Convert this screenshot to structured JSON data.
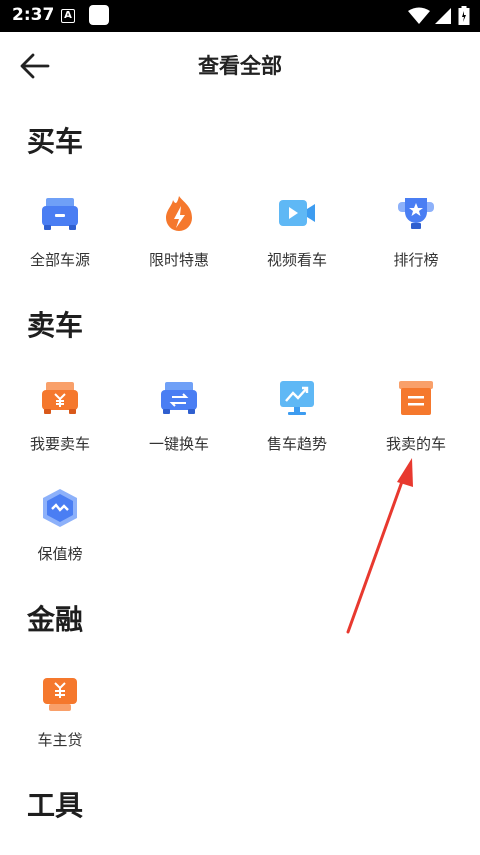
{
  "status_bar": {
    "time": "2:37",
    "icon_a": "A"
  },
  "header": {
    "title": "查看全部"
  },
  "sections": [
    {
      "title": "买车",
      "items": [
        "全部车源",
        "限时特惠",
        "视频看车",
        "排行榜"
      ]
    },
    {
      "title": "卖车",
      "items": [
        "我要卖车",
        "一键换车",
        "售车趋势",
        "我卖的车",
        "保值榜"
      ]
    },
    {
      "title": "金融",
      "items": [
        "车主贷"
      ]
    },
    {
      "title": "工具",
      "items": []
    }
  ],
  "icons": {
    "all-cars": "car-front-icon",
    "limited-offer": "flame-icon",
    "video-view": "video-camera-icon",
    "ranking": "trophy-icon",
    "sell-car": "car-yen-icon",
    "trade-in": "car-swap-icon",
    "sell-trend": "trend-chart-icon",
    "my-sold": "box-list-icon",
    "value-rank": "hexagon-trend-icon",
    "owner-loan": "loan-yen-icon"
  },
  "colors": {
    "blue": "#4a7ef3",
    "orange": "#f5782d",
    "annotation": "#e8392f"
  }
}
